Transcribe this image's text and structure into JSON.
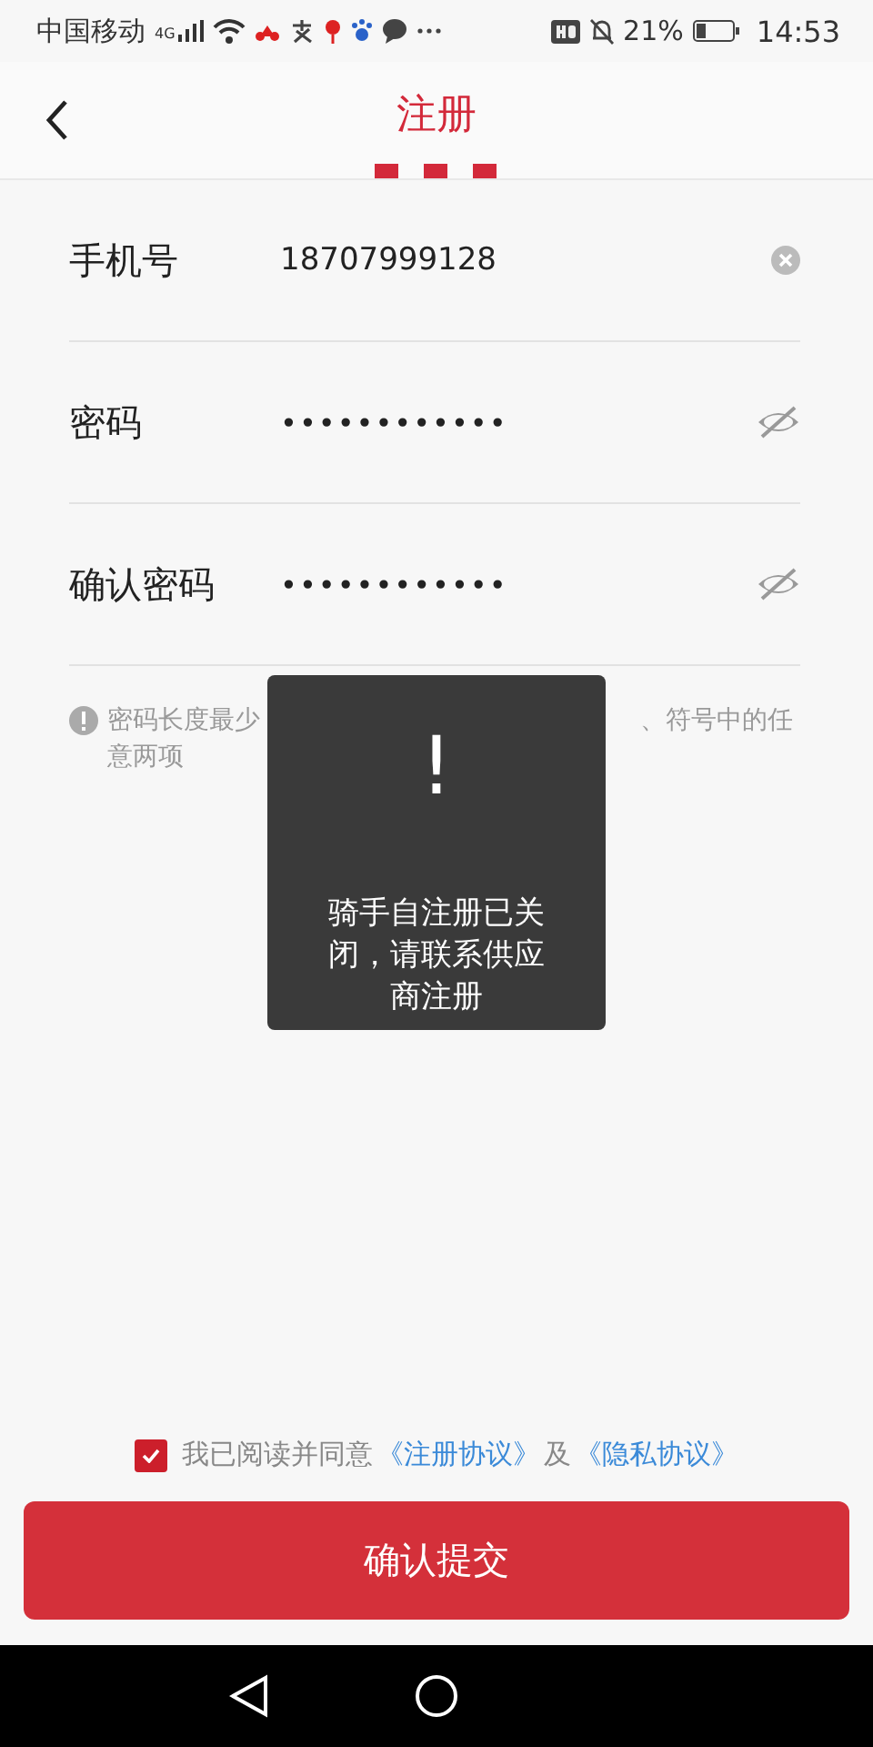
{
  "status_bar": {
    "carrier": "中国移动",
    "network": "4G",
    "battery": "21%",
    "time": "14:53"
  },
  "header": {
    "title": "注册"
  },
  "fields": [
    {
      "kind": "text",
      "label": "手机号",
      "value": "18707999128"
    },
    {
      "kind": "password",
      "label": "密码",
      "value": "••••••••••••"
    },
    {
      "kind": "password",
      "label": "确认密码",
      "value": "••••••••••••"
    }
  ],
  "hint": {
    "visible_start": "密码长度最少",
    "visible_end": "、符号中的任",
    "line_2": "意两项"
  },
  "toast": {
    "icon": "!",
    "message": "骑手自注册已关闭，请联系供应商注册"
  },
  "agreement": {
    "checked": true,
    "text": "我已阅读并同意",
    "link_1": "《注册协议》",
    "joiner": "及",
    "link_2": "《隐私协议》"
  },
  "submit_button": {
    "label": "确认提交"
  }
}
